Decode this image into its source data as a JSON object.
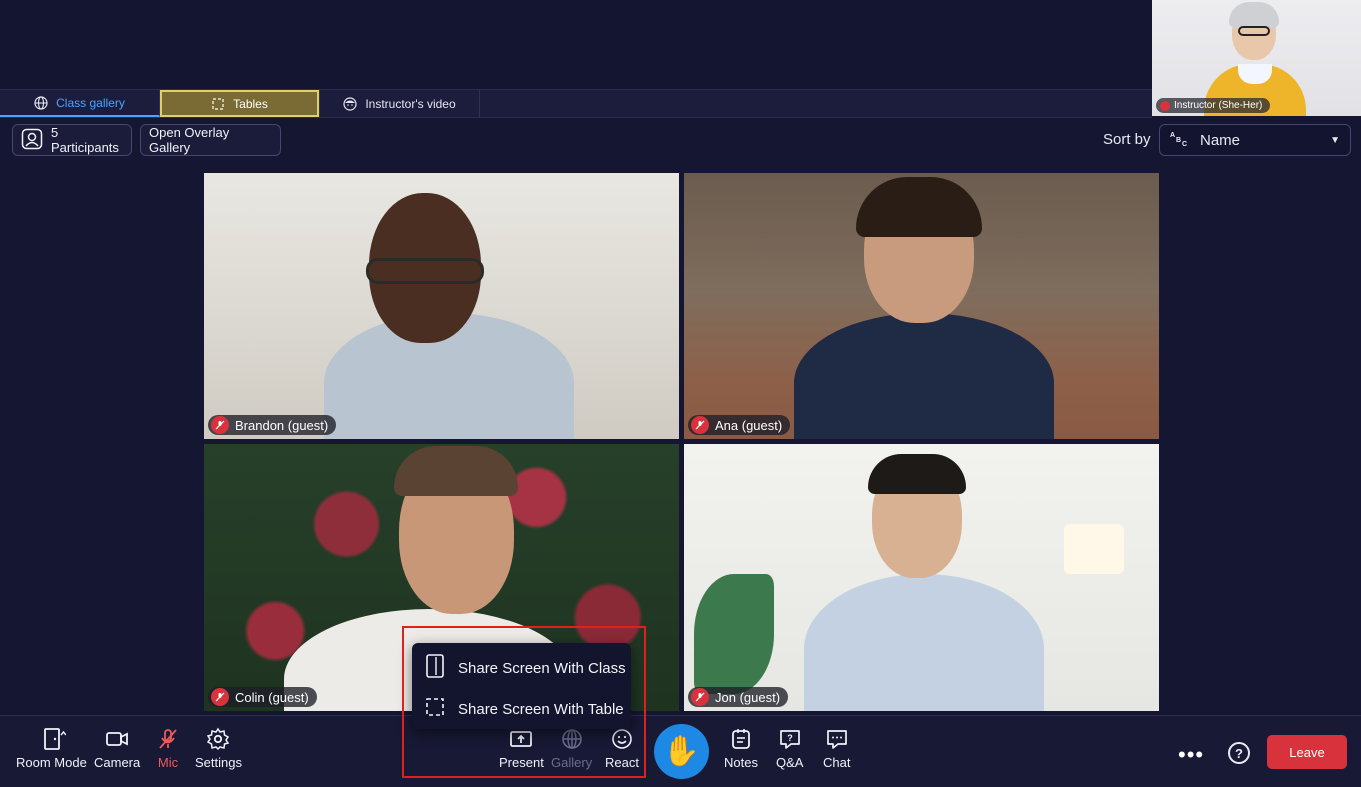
{
  "tabs": {
    "class_gallery": "Class gallery",
    "tables": "Tables",
    "instructor_video": "Instructor's video"
  },
  "instructor": {
    "label": "Instructor (She-Her)"
  },
  "controls": {
    "participants": "5 Participants",
    "overlay_gallery": "Open Overlay Gallery",
    "sort_by_label": "Sort by",
    "sort_value": "Name"
  },
  "participants": [
    {
      "name": "Brandon (guest)"
    },
    {
      "name": "Ana (guest)"
    },
    {
      "name": "Colin (guest)"
    },
    {
      "name": "Jon (guest)"
    }
  ],
  "share_menu": {
    "share_class": "Share Screen With Class",
    "share_table": "Share Screen With Table"
  },
  "toolbar": {
    "room_mode": "Room Mode",
    "camera": "Camera",
    "mic": "Mic",
    "settings": "Settings",
    "present": "Present",
    "gallery": "Gallery",
    "react": "React",
    "notes": "Notes",
    "qa": "Q&A",
    "chat": "Chat",
    "more": "•••",
    "help": "?",
    "leave": "Leave"
  },
  "colors": {
    "background": "#151632",
    "accent_blue": "#4aa3ff",
    "tables_highlight": "#e3cf63",
    "mic_off_red": "#d8323c",
    "raise_hand_blue": "#1e88e5",
    "annotation_red": "#e0201e"
  },
  "icons": {
    "class_gallery_tab": "globe-icon",
    "tables_tab": "selection-frame-icon",
    "instructor_tab": "face-icon",
    "raise_hand": "raised-hand-icon"
  }
}
